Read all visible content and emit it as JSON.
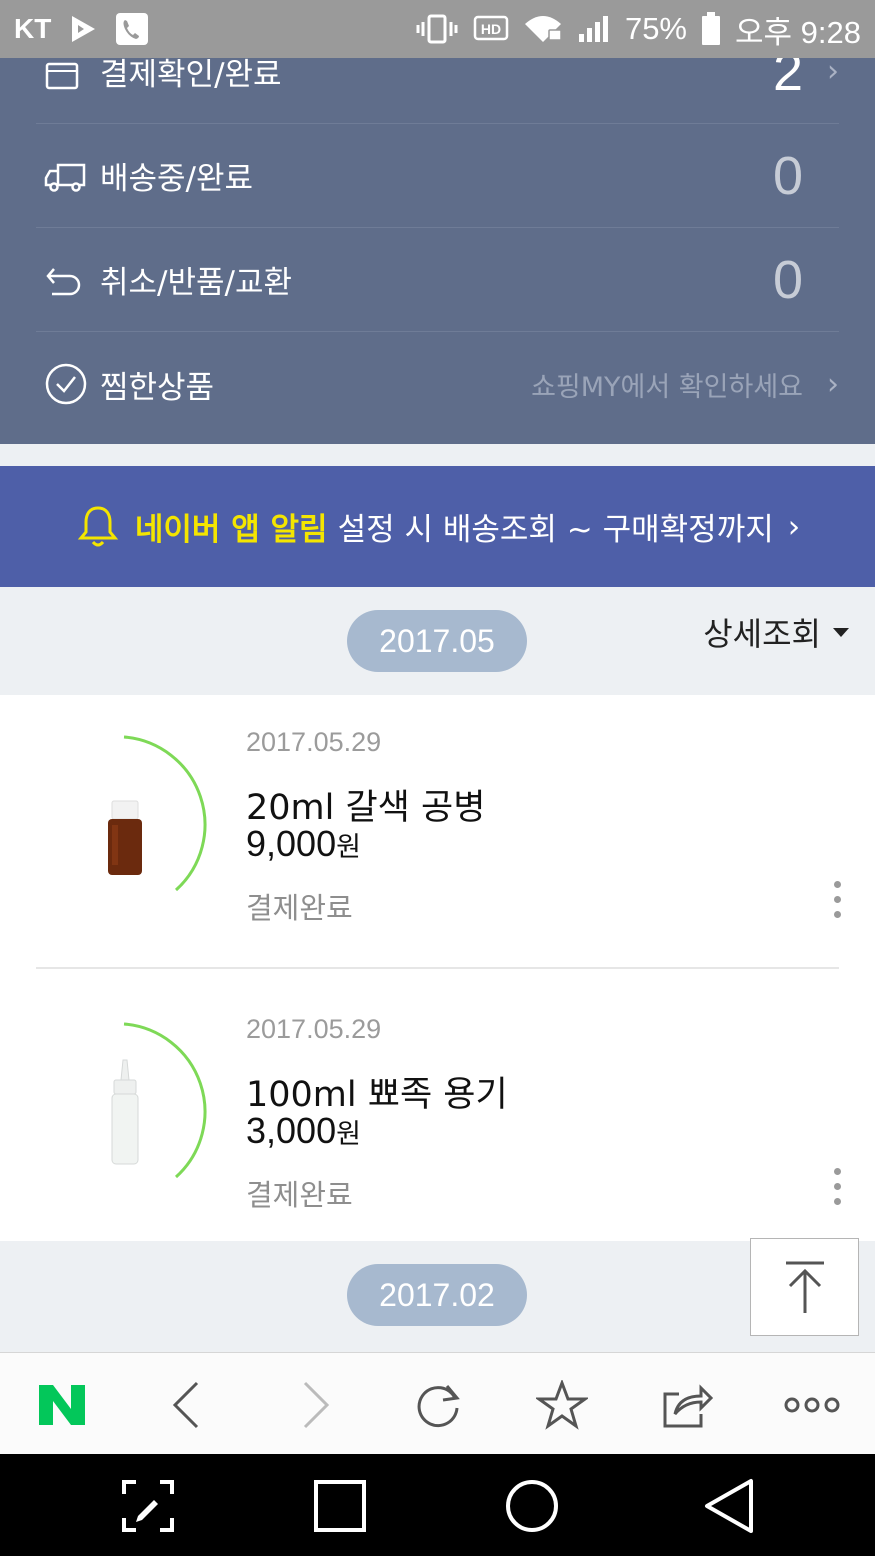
{
  "status_bar": {
    "carrier": "KT",
    "battery": "75%",
    "time": "오후 9:28",
    "icons": [
      "play-store-icon",
      "phone-icon",
      "vibrate-icon",
      "hd-icon",
      "wifi-icon",
      "signal-icon",
      "battery-icon"
    ]
  },
  "order_status": {
    "rows": [
      {
        "label": "결제확인/완료",
        "count": "2",
        "icon": "bag-icon"
      },
      {
        "label": "배송중/완료",
        "count": "0",
        "icon": "truck-icon"
      },
      {
        "label": "취소/반품/교환",
        "count": "0",
        "icon": "return-icon"
      },
      {
        "label": "찜한상품",
        "hint": "쇼핑MY에서 확인하세요",
        "icon": "check-circle-icon"
      }
    ]
  },
  "banner": {
    "highlight": "네이버 앱 알림",
    "text": "설정 시 배송조회 ~ 구매확정까지",
    "icon": "bell-icon"
  },
  "sections": [
    {
      "month": "2017.05",
      "detail_label": "상세조회"
    },
    {
      "month": "2017.02"
    }
  ],
  "orders": [
    {
      "date": "2017.05.29",
      "name": "20ml 갈색 공병",
      "price": "9,000",
      "currency": "원",
      "status": "결제완료"
    },
    {
      "date": "2017.05.29",
      "name": "100ml 뾰족 용기",
      "price": "3,000",
      "currency": "원",
      "status": "결제완료"
    }
  ],
  "colors": {
    "panel": "#5f6d8a",
    "banner": "#4e5fa8",
    "highlight": "#f4e500",
    "pill": "#a7b9cf",
    "arc": "#7ed957",
    "naver": "#03c75a"
  }
}
